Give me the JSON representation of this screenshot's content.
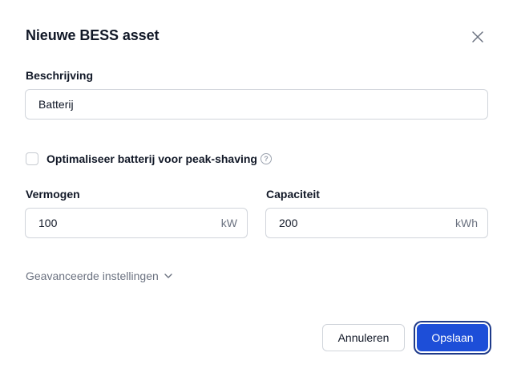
{
  "dialog": {
    "title": "Nieuwe BESS asset",
    "close_icon": "close-icon"
  },
  "description": {
    "label": "Beschrijving",
    "value": "Batterij"
  },
  "peak_shaving": {
    "label": "Optimaliseer batterij voor peak-shaving",
    "checked": false,
    "help_icon": "question-circle-icon",
    "help_glyph": "?"
  },
  "power": {
    "label": "Vermogen",
    "value": "100",
    "unit": "kW"
  },
  "capacity": {
    "label": "Capaciteit",
    "value": "200",
    "unit": "kWh"
  },
  "advanced": {
    "label": "Geavanceerde instellingen",
    "icon": "chevron-down-icon"
  },
  "actions": {
    "cancel_label": "Annuleren",
    "save_label": "Opslaan"
  },
  "colors": {
    "primary": "#1d4ed8",
    "border": "#d1d5db",
    "muted_text": "#6b7280"
  }
}
